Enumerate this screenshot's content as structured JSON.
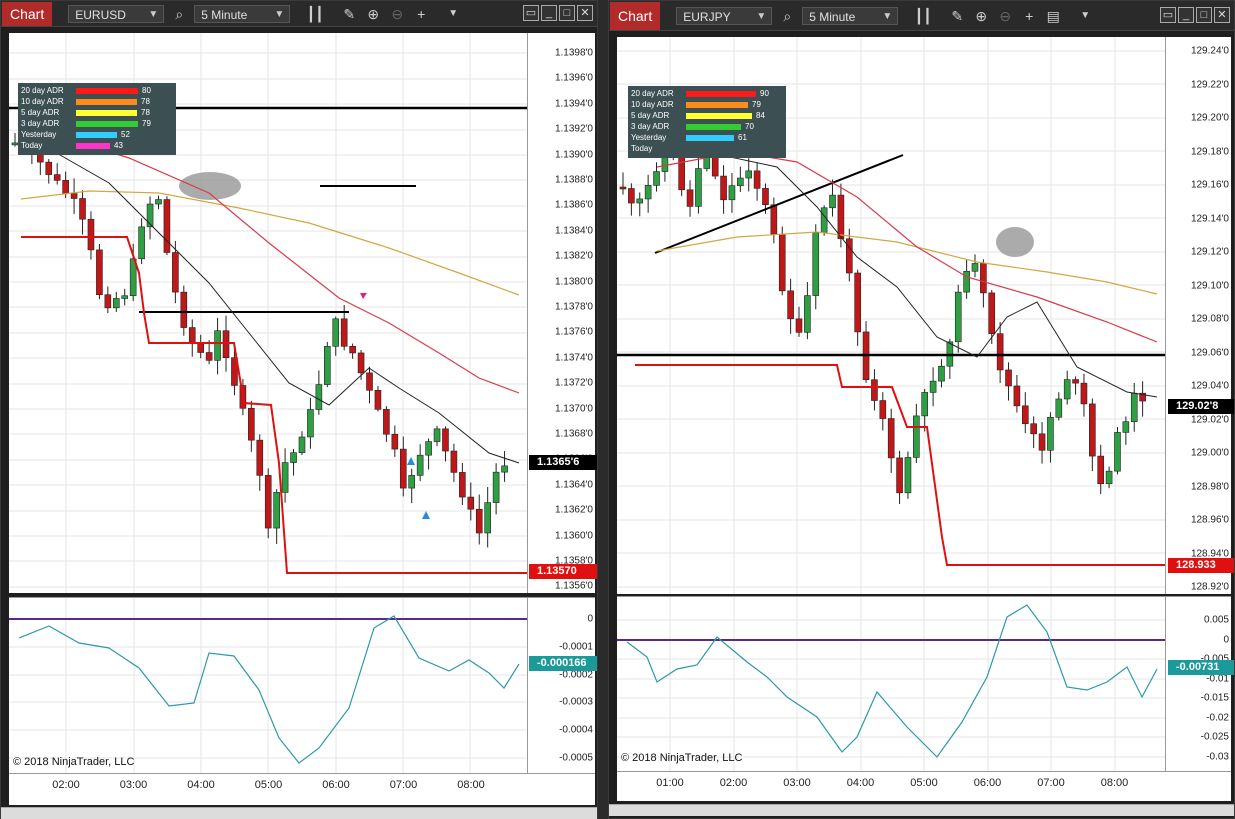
{
  "left": {
    "chart_button": "Chart",
    "instrument": "EURUSD",
    "timeframe": "5 Minute",
    "price_ticks": [
      "1.1398'0",
      "1.1396'0",
      "1.1394'0",
      "1.1392'0",
      "1.1390'0",
      "1.1388'0",
      "1.1386'0",
      "1.1384'0",
      "1.1382'0",
      "1.1380'0",
      "1.1378'0",
      "1.1376'0",
      "1.1374'0",
      "1.1372'0",
      "1.1370'0",
      "1.1368'0",
      "1.1366'0",
      "1.1364'0",
      "1.1362'0",
      "1.1360'0",
      "1.1358'0",
      "1.1356'0"
    ],
    "osc_ticks": [
      "0",
      "-0.0001",
      "-0.0002",
      "-0.0003",
      "-0.0004",
      "-0.0005"
    ],
    "time_ticks": [
      "02:00",
      "03:00",
      "04:00",
      "05:00",
      "06:00",
      "07:00",
      "08:00"
    ],
    "last_price": "1.1365'6",
    "stop_price": "1.13570",
    "osc_value": "-0.000166",
    "copyright": "© 2018 NinjaTrader, LLC",
    "adr": [
      {
        "label": "20 day ADR",
        "value": "80",
        "color": "#ff1a1a"
      },
      {
        "label": "10 day ADR",
        "value": "78",
        "color": "#ff8c1a"
      },
      {
        "label": "5 day ADR",
        "value": "78",
        "color": "#ffff33"
      },
      {
        "label": "3 day ADR",
        "value": "79",
        "color": "#33cc33"
      },
      {
        "label": "Yesterday",
        "value": "52",
        "color": "#33ccff"
      },
      {
        "label": "Today",
        "value": "43",
        "color": "#ff33cc"
      }
    ]
  },
  "right": {
    "chart_button": "Chart",
    "instrument": "EURJPY",
    "timeframe": "5 Minute",
    "price_ticks": [
      "129.24'0",
      "129.22'0",
      "129.20'0",
      "129.18'0",
      "129.16'0",
      "129.14'0",
      "129.12'0",
      "129.10'0",
      "129.08'0",
      "129.06'0",
      "129.04'0",
      "129.02'0",
      "129.00'0",
      "128.98'0",
      "128.96'0",
      "128.94'0",
      "128.92'0"
    ],
    "osc_ticks": [
      "0.005",
      "0",
      "-0.005",
      "-0.01",
      "-0.015",
      "-0.02",
      "-0.025",
      "-0.03"
    ],
    "time_ticks": [
      "01:00",
      "02:00",
      "03:00",
      "04:00",
      "05:00",
      "06:00",
      "07:00",
      "08:00"
    ],
    "last_price": "129.02'8",
    "stop_price": "128.933",
    "osc_value": "-0.00731",
    "copyright": "© 2018 NinjaTrader, LLC",
    "adr": [
      {
        "label": "20 day ADR",
        "value": "90",
        "color": "#ff1a1a"
      },
      {
        "label": "10 day ADR",
        "value": "79",
        "color": "#ff8c1a"
      },
      {
        "label": "5 day ADR",
        "value": "84",
        "color": "#ffff33"
      },
      {
        "label": "3 day ADR",
        "value": "70",
        "color": "#33cc33"
      },
      {
        "label": "Yesterday",
        "value": "61",
        "color": "#33ccff"
      },
      {
        "label": "Today",
        "value": "",
        "color": "#ff33cc"
      }
    ]
  },
  "icons": [
    "bars-icon",
    "pencil-icon",
    "zoom-in-icon",
    "zoom-out-icon",
    "crosshair-icon",
    "search-icon",
    "dropdown-icon",
    "minimize-icon",
    "maximize-icon",
    "close-icon"
  ]
}
